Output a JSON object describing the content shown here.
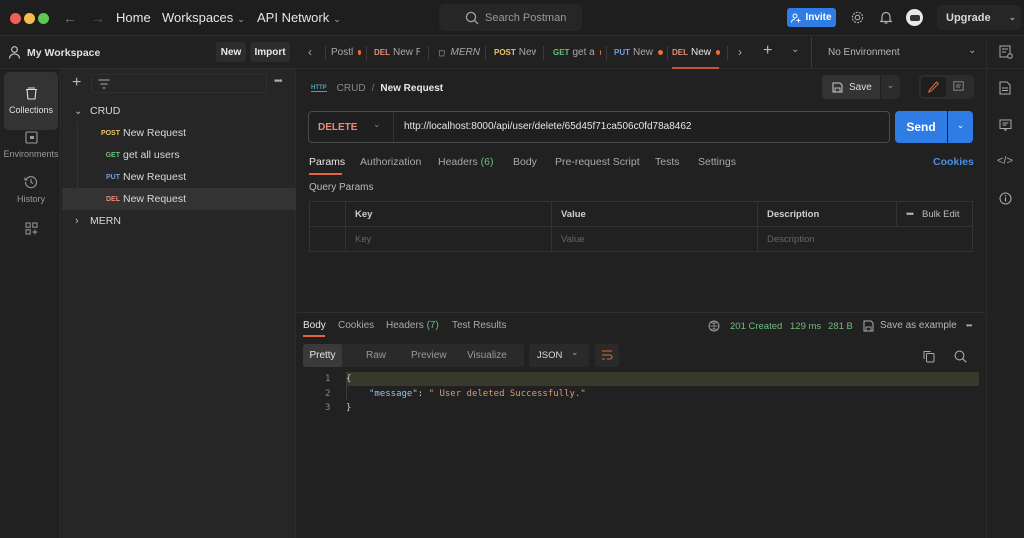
{
  "titlebar": {
    "nav": {
      "home": "Home",
      "workspaces": "Workspaces",
      "api_network": "API Network"
    },
    "search_placeholder": "Search Postman",
    "invite_label": "Invite",
    "upgrade_label": "Upgrade",
    "colors": {
      "close": "#ee5f57",
      "minimize": "#f5bd4f",
      "maximize": "#5fc653",
      "invite_bg": "#2f7ce4"
    }
  },
  "workspace": {
    "name": "My Workspace",
    "new_label": "New",
    "import_label": "Import"
  },
  "tabs": {
    "items": [
      {
        "method": "",
        "label": "Postl",
        "dirty": true
      },
      {
        "method": "DEL",
        "label": "New R",
        "dirty": false
      },
      {
        "method": "",
        "label": "MERN",
        "dirty": false,
        "icon": "collection-icon"
      },
      {
        "method": "POST",
        "label": "New I",
        "dirty": false
      },
      {
        "method": "GET",
        "label": "get a",
        "dirty": true
      },
      {
        "method": "PUT",
        "label": "New",
        "dirty": true
      },
      {
        "method": "DEL",
        "label": "New",
        "dirty": true,
        "active": true
      }
    ],
    "environment": "No Environment"
  },
  "rail": {
    "items": [
      {
        "label": "Collections",
        "icon": "collections-icon",
        "active": true
      },
      {
        "label": "Environments",
        "icon": "environments-icon"
      },
      {
        "label": "History",
        "icon": "history-icon"
      },
      {
        "label": "",
        "icon": "configure-workbench-icon"
      }
    ]
  },
  "collections": {
    "tree": [
      {
        "type": "collection",
        "name": "CRUD",
        "expanded": true,
        "children": [
          {
            "method": "POST",
            "name": "New Request"
          },
          {
            "method": "GET",
            "name": "get all users"
          },
          {
            "method": "PUT",
            "name": "New Request"
          },
          {
            "method": "DEL",
            "name": "New Request",
            "selected": true
          }
        ]
      },
      {
        "type": "collection",
        "name": "MERN",
        "expanded": false
      }
    ]
  },
  "method_colors": {
    "GET": "#6bbd7b",
    "POST": "#e9c46a",
    "PUT": "#6f9fd8",
    "DEL": "#e78c7c",
    "DELETE": "#e78c7c"
  },
  "request": {
    "breadcrumb": {
      "collection": "CRUD",
      "separator": "/",
      "name": "New Request"
    },
    "save_label": "Save",
    "method": "DELETE",
    "url": "http://localhost:8000/api/user/delete/65d45f71ca506c0fd78a8462",
    "send_label": "Send",
    "tabs": [
      {
        "label": "Params",
        "active": true
      },
      {
        "label": "Authorization"
      },
      {
        "label": "Headers",
        "count": "(6)"
      },
      {
        "label": "Body"
      },
      {
        "label": "Pre-request Script"
      },
      {
        "label": "Tests"
      },
      {
        "label": "Settings"
      }
    ],
    "cookies_label": "Cookies",
    "query_params_title": "Query Params",
    "params_table": {
      "headers": [
        "Key",
        "Value",
        "Description"
      ],
      "bulk_edit": "Bulk Edit",
      "placeholders": [
        "Key",
        "Value",
        "Description"
      ]
    }
  },
  "response": {
    "tabs": [
      {
        "label": "Body",
        "active": true
      },
      {
        "label": "Cookies"
      },
      {
        "label": "Headers",
        "count": "(7)"
      },
      {
        "label": "Test Results"
      }
    ],
    "status": "201 Created",
    "time": "129 ms",
    "size": "281 B",
    "save_example_label": "Save as example",
    "view_modes": [
      "Pretty",
      "Raw",
      "Preview",
      "Visualize"
    ],
    "active_view": "Pretty",
    "format": "JSON",
    "lines": [
      {
        "n": "1",
        "text": "{"
      },
      {
        "n": "2",
        "key": "\"message\"",
        "colon": ": ",
        "value": "\" User deleted Successfully.\""
      },
      {
        "n": "3",
        "text": "}"
      }
    ],
    "status_color": "#6bbd7b"
  }
}
